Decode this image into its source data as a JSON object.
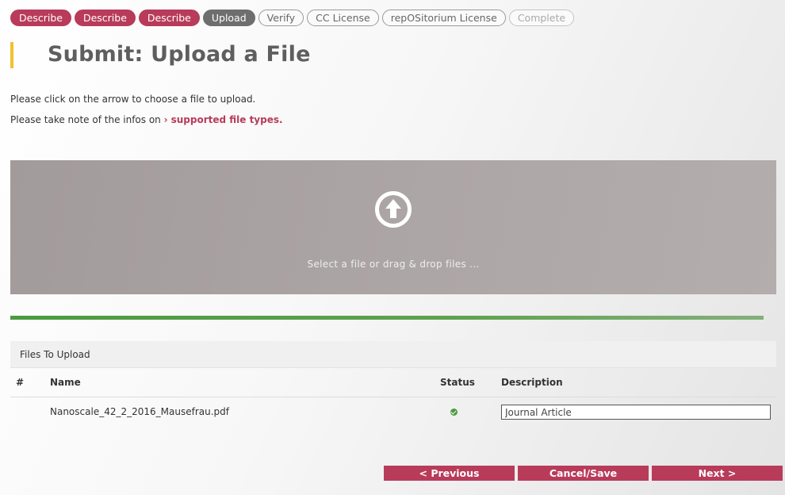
{
  "steps": [
    {
      "label": "Describe",
      "state": "done"
    },
    {
      "label": "Describe",
      "state": "done"
    },
    {
      "label": "Describe",
      "state": "done"
    },
    {
      "label": "Upload",
      "state": "current"
    },
    {
      "label": "Verify",
      "state": "todo"
    },
    {
      "label": "CC License",
      "state": "todo"
    },
    {
      "label": "repOSitorium License",
      "state": "todo"
    },
    {
      "label": "Complete",
      "state": "disabled"
    }
  ],
  "page": {
    "title": "Submit: Upload a File",
    "info_line1": "Please click on the arrow to choose a file to upload.",
    "info_line2_prefix": "Please take note of the infos on",
    "info_link": "supported file types."
  },
  "dropzone": {
    "text": "Select a file or drag & drop files ...",
    "icon": "upload-arrow-circle-icon"
  },
  "progress": {
    "fraction": 1.0
  },
  "files_panel": {
    "title": "Files To Upload",
    "columns": {
      "num": "#",
      "name": "Name",
      "status": "Status",
      "description": "Description"
    },
    "rows": [
      {
        "name": "Nanoscale_42_2_2016_Mausefrau.pdf",
        "status": "ok",
        "description": "Journal Article"
      }
    ]
  },
  "buttons": {
    "previous": "< Previous",
    "cancel_save": "Cancel/Save",
    "next": "Next >"
  },
  "colors": {
    "accent": "#b83b5a",
    "title_bar": "#f2c12e",
    "progress": "#4a9b3f"
  }
}
